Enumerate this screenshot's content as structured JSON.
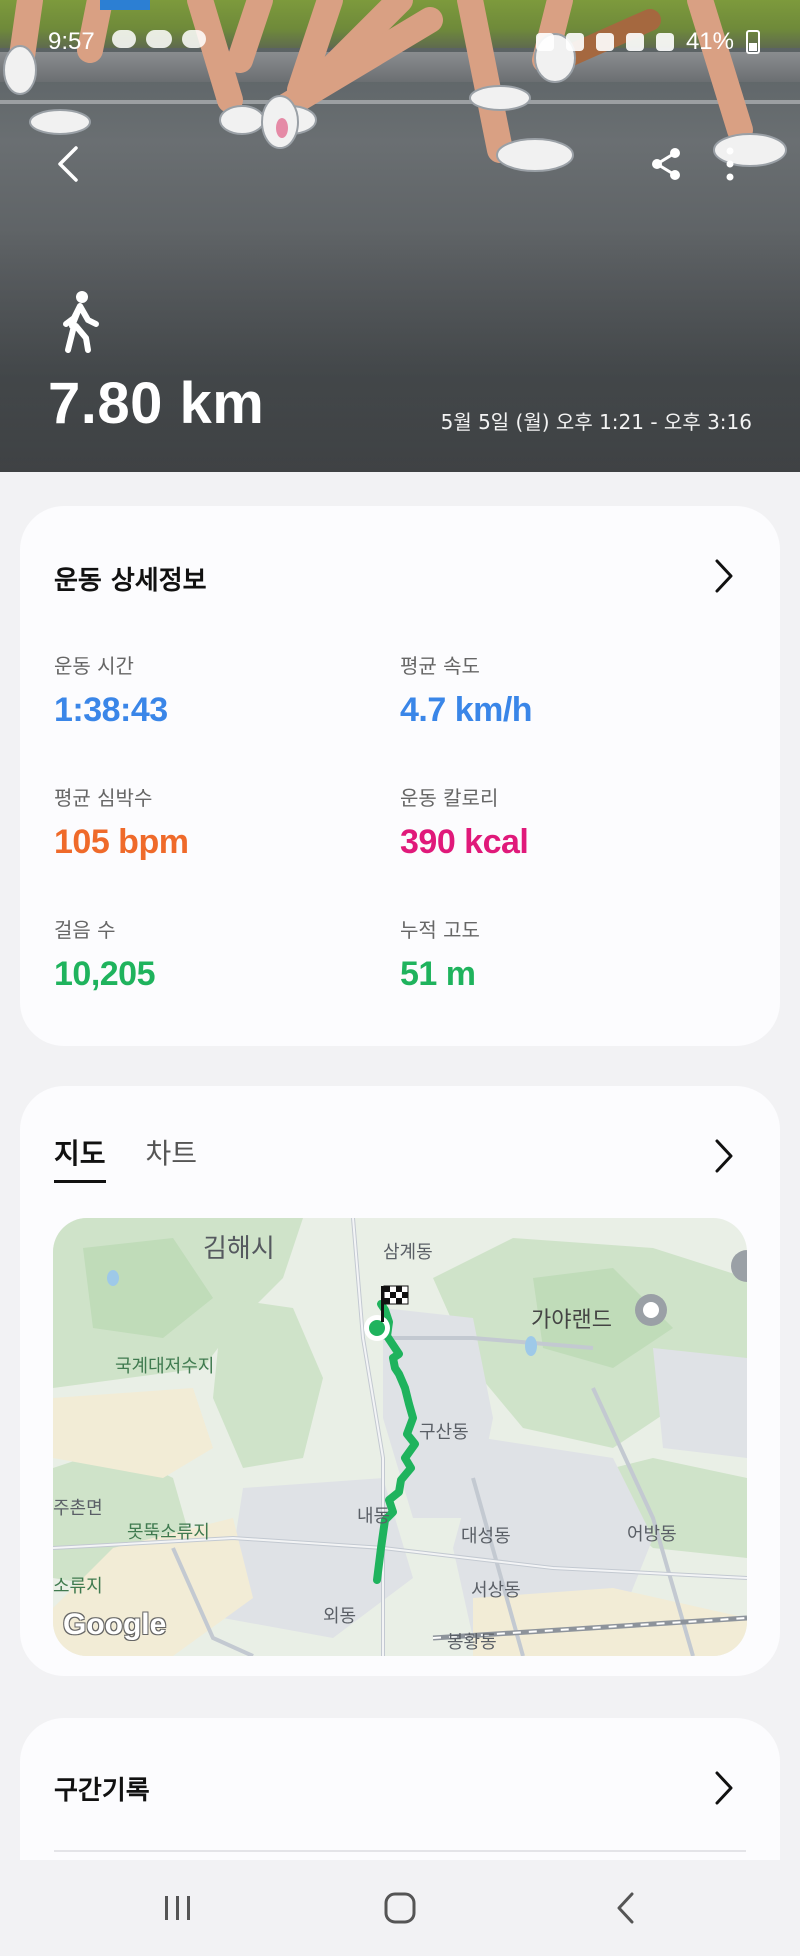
{
  "status_bar": {
    "time": "9:57",
    "battery": "41%"
  },
  "hero": {
    "activity_icon": "walk-icon",
    "distance": "7.80 km",
    "date_range": "5월 5일 (월) 오후 1:21 - 오후 3:16"
  },
  "details": {
    "title": "운동 상세정보",
    "stats": [
      {
        "label": "운동 시간",
        "value": "1:38:43",
        "color": "#3a86e8"
      },
      {
        "label": "평균 속도",
        "value": "4.7 km/h",
        "color": "#3a86e8"
      },
      {
        "label": "평균 심박수",
        "value": "105 bpm",
        "color": "#ef6a2a"
      },
      {
        "label": "운동 칼로리",
        "value": "390 kcal",
        "color": "#e0197a"
      },
      {
        "label": "걸음 수",
        "value": "10,205",
        "color": "#1fb35d"
      },
      {
        "label": "누적 고도",
        "value": "51 m",
        "color": "#1fb35d"
      }
    ]
  },
  "map_card": {
    "tabs": [
      {
        "label": "지도",
        "active": true
      },
      {
        "label": "차트",
        "active": false
      }
    ],
    "route_color": "#1fb35d",
    "map_labels": {
      "gimhae": "김해시",
      "samgye": "삼계동",
      "gaya": "가야랜드",
      "reservoir": "국계대저수지",
      "gusan": "구산동",
      "jucheon": "주촌면",
      "motttuk": "못뚝소류지",
      "naedong": "내동",
      "daeseong": "대성동",
      "eobang": "어방동",
      "soryuji": "소류지",
      "seosang": "서상동",
      "oedong": "외동",
      "bonghwang": "봉황동"
    },
    "google": "Google"
  },
  "segments": {
    "title": "구간기록"
  },
  "nav": {
    "recent": "recent-apps-icon",
    "home": "home-icon",
    "back": "back-icon"
  }
}
